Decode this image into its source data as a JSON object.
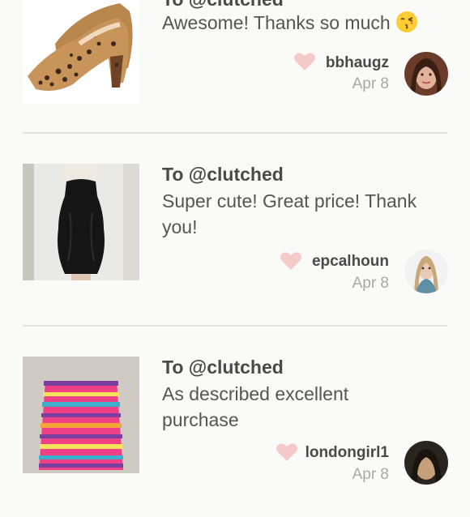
{
  "reviews": [
    {
      "to": "To @clutched",
      "message": "Awesome! Thanks so much",
      "emoji": "kissing-face-emoji",
      "username": "bbhaugz",
      "date": "Apr 8",
      "item": "leopard-pumps-image",
      "avatar": "avatar-bbhaugz"
    },
    {
      "to": "To @clutched",
      "message": "Super cute! Great price! Thank you!",
      "username": "epcalhoun",
      "date": "Apr 8",
      "item": "black-strapless-dress-image",
      "avatar": "avatar-epcalhoun"
    },
    {
      "to": "To @clutched",
      "message": "As described excellent purchase",
      "username": "londongirl1",
      "date": "Apr 8",
      "item": "striped-skirt-image",
      "avatar": "avatar-londongirl1"
    }
  ],
  "colors": {
    "heart": "#f6c9c9",
    "text_dark": "#4a4a4a",
    "text_muted": "#a8a8a8",
    "divider": "#e4e4e2",
    "background": "#fafaf9"
  }
}
